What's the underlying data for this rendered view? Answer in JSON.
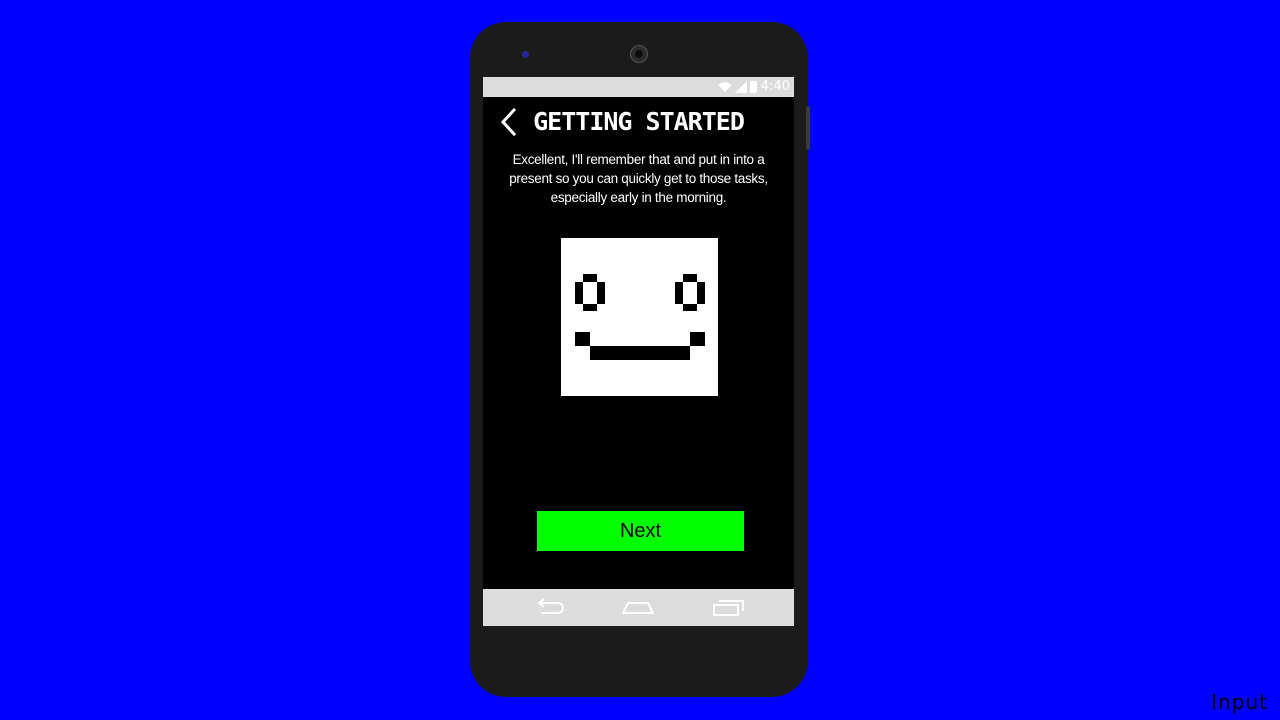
{
  "statusbar": {
    "time": "4:40",
    "icons": [
      "wifi-icon",
      "signal-icon",
      "battery-icon"
    ]
  },
  "header": {
    "back_icon": "chevron-left-icon",
    "title": "GETTING STARTED"
  },
  "main": {
    "message": "Excellent, I'll remember that and put in into a present so you can quickly get to those tasks, especially early in the morning.",
    "mascot_icon": "pixel-smiley-face-icon",
    "next_label": "Next"
  },
  "navbar": {
    "icons": [
      "nav-back-icon",
      "nav-home-icon",
      "nav-recents-icon"
    ]
  },
  "overlay": {
    "watermark": "Input"
  },
  "colors": {
    "background": "#0000ff",
    "phone_body": "#1b1b1b",
    "screen": "#000000",
    "system_bars": "#dcdcdc",
    "accent_button": "#00ff00",
    "text": "#ffffff"
  }
}
